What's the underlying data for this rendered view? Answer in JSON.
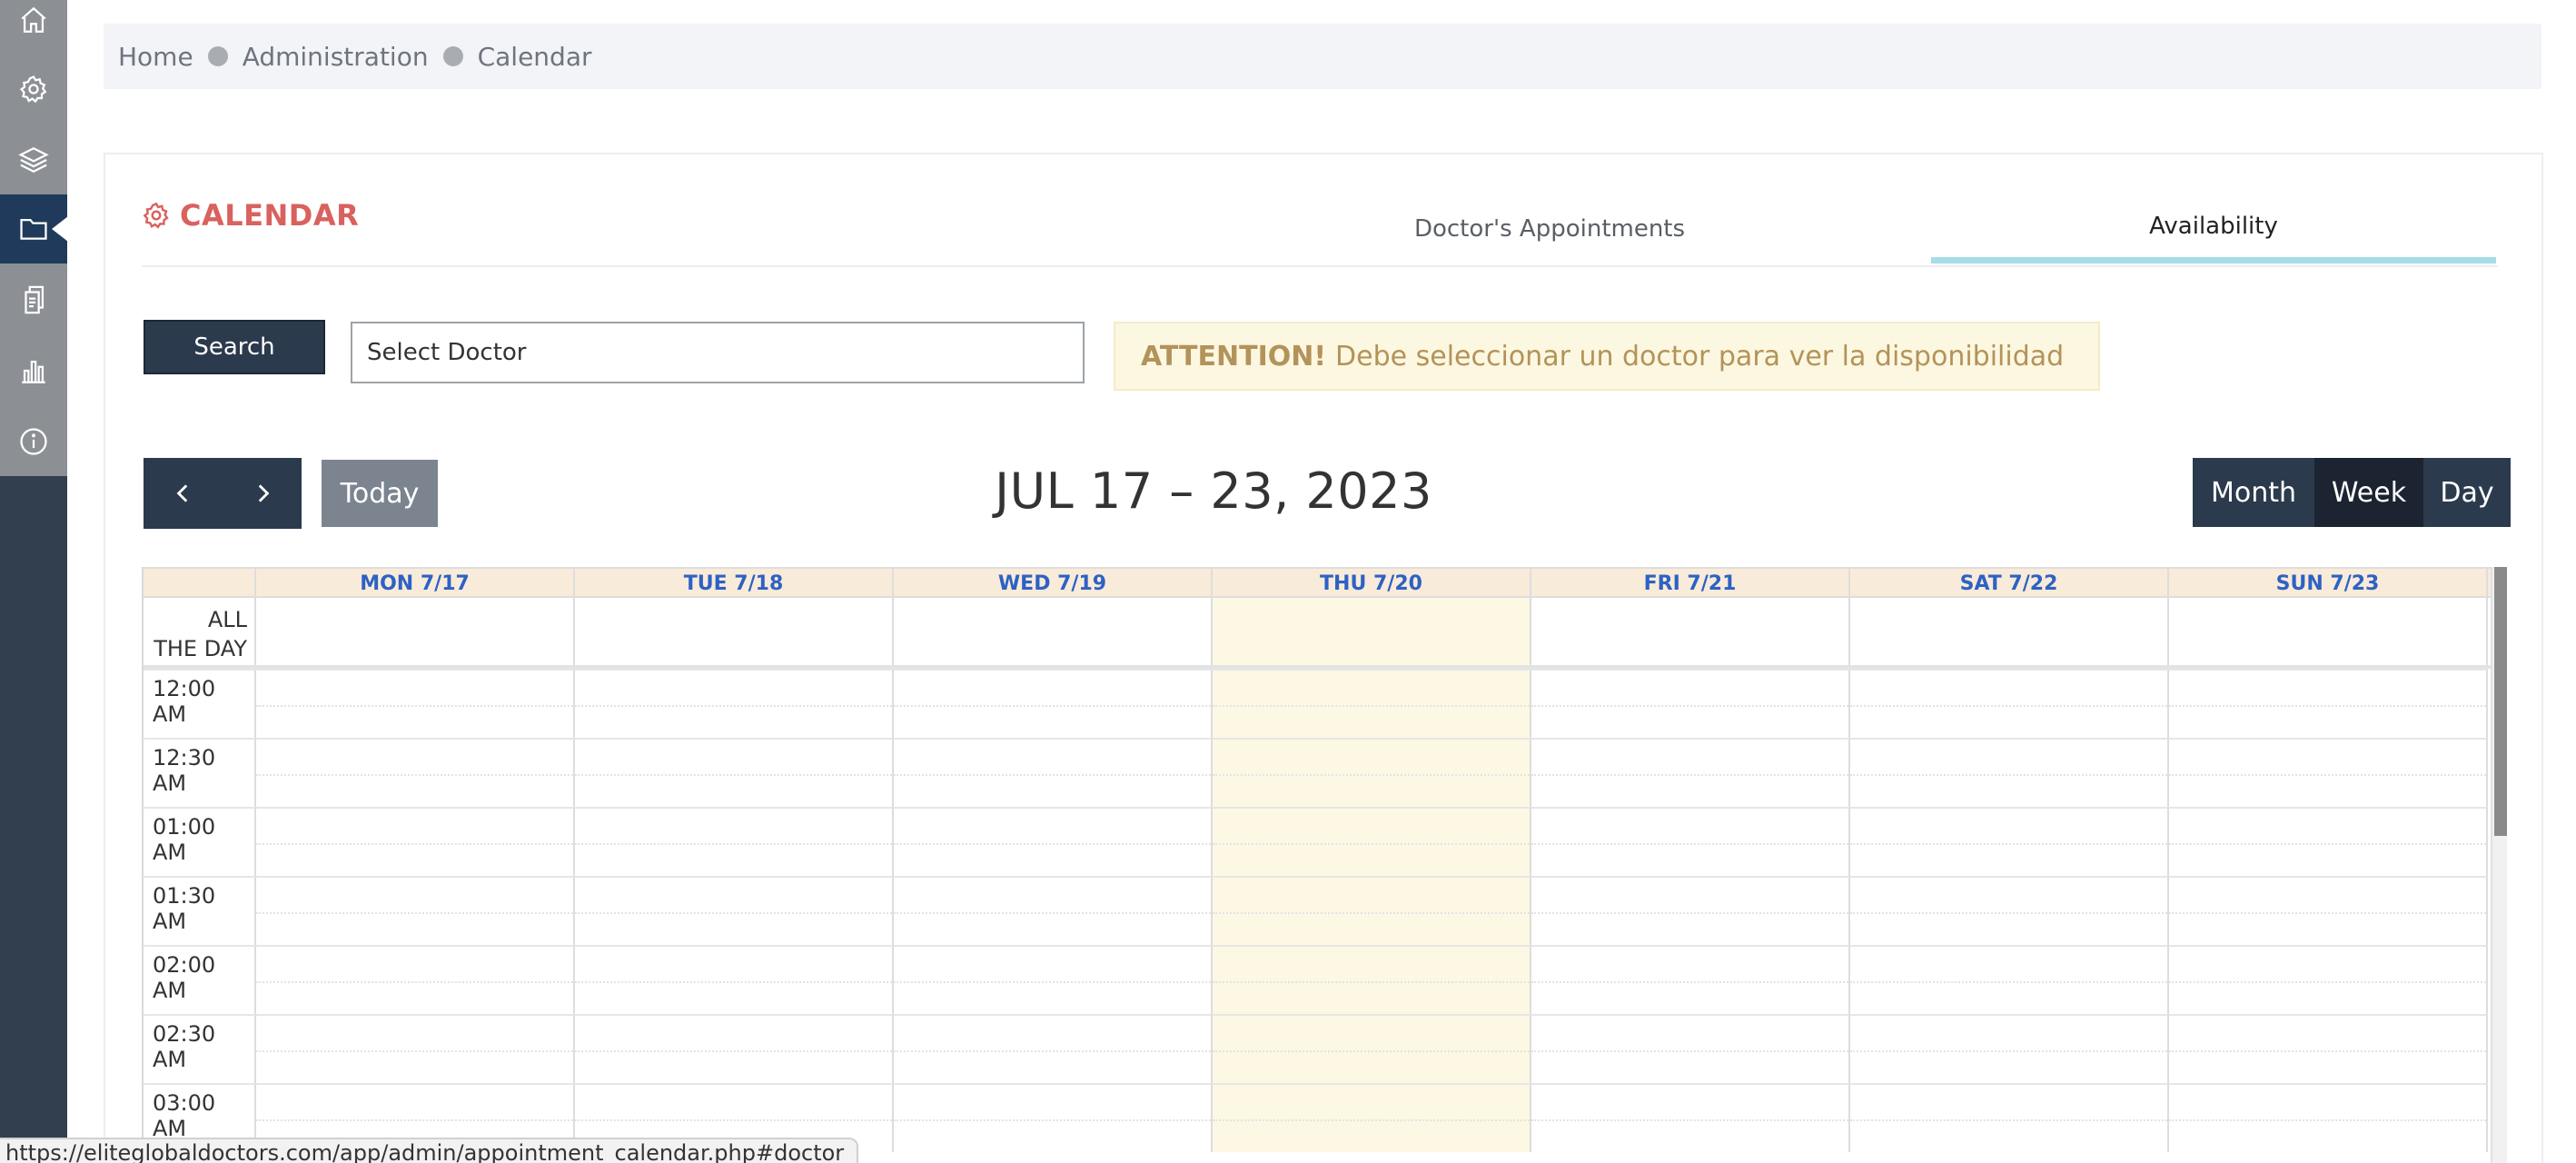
{
  "sidebar": {
    "items": [
      {
        "icon": "home-icon"
      },
      {
        "icon": "gear-icon"
      },
      {
        "icon": "layers-icon"
      },
      {
        "icon": "folder-icon",
        "active": true
      },
      {
        "icon": "documents-icon"
      },
      {
        "icon": "bar-chart-icon"
      },
      {
        "icon": "info-icon"
      }
    ]
  },
  "breadcrumb": {
    "items": [
      "Home",
      "Administration",
      "Calendar"
    ]
  },
  "panel": {
    "title": "CALENDAR",
    "tabs": [
      {
        "label": "Doctor's Appointments",
        "active": false
      },
      {
        "label": "Availability",
        "active": true
      }
    ]
  },
  "search": {
    "button_label": "Search",
    "doctor_select_value": "Select Doctor"
  },
  "alert": {
    "strong": "ATTENTION!",
    "message": "Debe seleccionar un doctor para ver la disponibilidad"
  },
  "toolbar": {
    "today_label": "Today",
    "range_title": "JUL 17 – 23, 2023",
    "views": {
      "month": "Month",
      "week": "Week",
      "day": "Day"
    },
    "active_view": "week"
  },
  "calendar": {
    "days": [
      "MON 7/17",
      "TUE 7/18",
      "WED 7/19",
      "THU 7/20",
      "FRI 7/21",
      "SAT 7/22",
      "SUN 7/23"
    ],
    "today_index": 3,
    "allday_line1": "ALL",
    "allday_line2": "THE DAY",
    "times": [
      "12:00 AM",
      "12:30 AM",
      "01:00 AM",
      "01:30 AM",
      "02:00 AM",
      "02:30 AM",
      "03:00 AM"
    ]
  },
  "status_url": "https://eliteglobaldoctors.com/app/admin/appointment_calendar.php#doctor",
  "colors": {
    "sidebar_bg": "#323f4f",
    "accent_red": "#d9615e",
    "tab_underline": "#a6dde6",
    "today_highlight": "#fcf8e3",
    "header_bg": "#f9ebd9",
    "day_text": "#2d62c4"
  }
}
